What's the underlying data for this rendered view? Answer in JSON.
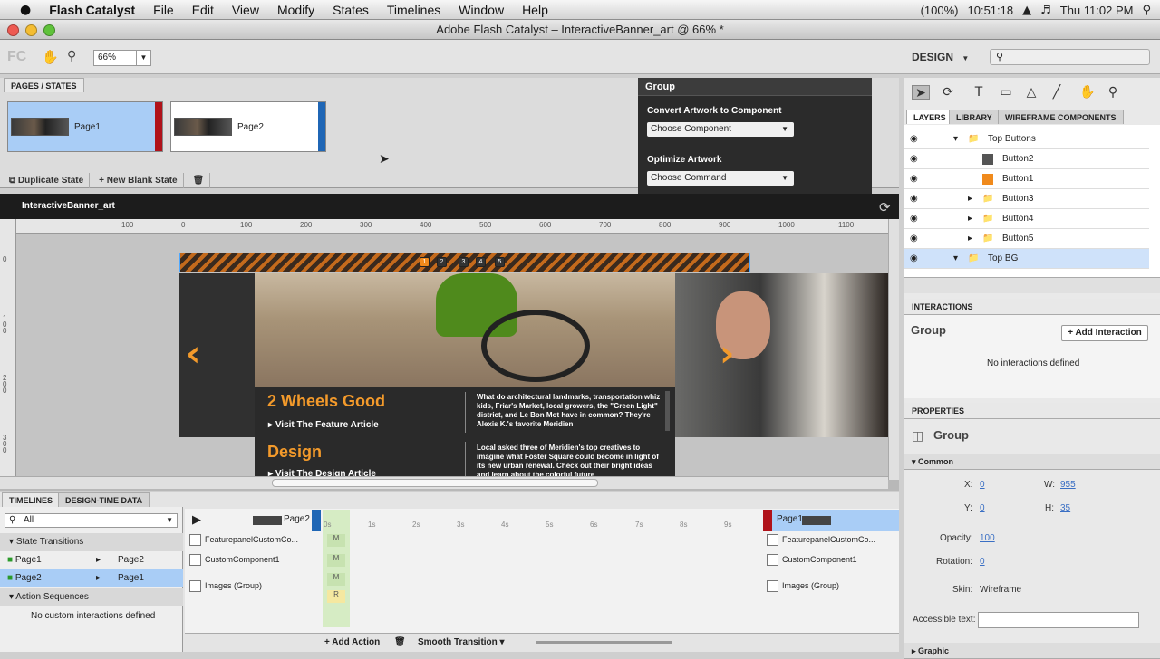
{
  "menubar": {
    "apple": "",
    "app": "Flash Catalyst",
    "items": [
      "File",
      "Edit",
      "View",
      "Modify",
      "States",
      "Timelines",
      "Window",
      "Help"
    ],
    "battery": "(100%)",
    "time": "10:51:18",
    "clock": "Thu 11:02 PM"
  },
  "window": {
    "title": "Adobe Flash Catalyst – InteractiveBanner_art @ 66% *"
  },
  "toolbar": {
    "logo": "FC",
    "zoom": "66%",
    "workspace": "DESIGN"
  },
  "pages": {
    "tab": "PAGES / STATES",
    "items": [
      {
        "label": "Page1"
      },
      {
        "label": "Page2"
      }
    ],
    "duplicate": "Duplicate State",
    "new_blank": "New Blank State"
  },
  "hud": {
    "title": "Group",
    "convert_label": "Convert Artwork to Component",
    "convert_value": "Choose Component",
    "optimize_label": "Optimize Artwork",
    "optimize_value": "Choose Command"
  },
  "artboard": {
    "name": "InteractiveBanner_art",
    "ruler_h": [
      "100",
      "0",
      "100",
      "200",
      "300",
      "400",
      "500",
      "600",
      "700",
      "800",
      "900",
      "1000",
      "1100"
    ],
    "ruler_v": [
      "0",
      "1 0 0",
      "2 0 0",
      "3 0 0"
    ]
  },
  "banner": {
    "nav_dots": [
      "1",
      "2",
      "3",
      "4",
      "5"
    ],
    "feature1": {
      "title": "2 Wheels Good",
      "link": "Visit The Feature Article",
      "text": "What do architectural landmarks, transportation whiz kids, Friar's Market, local growers, the \"Green Light\" district, and Le Bon Mot have in common? They're Alexis K.'s favorite Meridien"
    },
    "feature2": {
      "title": "Design",
      "link": "Visit The Design Article",
      "text": "Local asked three of Meridien's top creatives to imagine what Foster Square could become in light of its new urban renewal. Check out their bright ideas and learn about the colorful future"
    }
  },
  "timelines": {
    "tabs": [
      "TIMELINES",
      "DESIGN-TIME DATA"
    ],
    "filter": "All",
    "state_transitions": "State Transitions",
    "transitions": [
      {
        "from": "Page1",
        "to": "Page2"
      },
      {
        "from": "Page2",
        "to": "Page1"
      }
    ],
    "action_sequences": "Action Sequences",
    "no_custom": "No custom interactions defined",
    "from_state": "Page2",
    "to_state": "Page1",
    "ticks": [
      "0s",
      "1s",
      "2s",
      "3s",
      "4s",
      "5s",
      "6s",
      "7s",
      "8s",
      "9s"
    ],
    "left_rows": [
      "FeaturepanelCustomCo...",
      "CustomComponent1",
      "Images (Group)"
    ],
    "right_rows": [
      "FeaturepanelCustomCo...",
      "CustomComponent1",
      "Images (Group)"
    ],
    "markers": [
      "M",
      "M",
      "M",
      "R"
    ],
    "add_action": "Add Action",
    "smooth": "Smooth Transition"
  },
  "layers": {
    "tabs": [
      "LAYERS",
      "LIBRARY",
      "WIREFRAME COMPONENTS"
    ],
    "rows": [
      {
        "name": "Top Buttons"
      },
      {
        "name": "Button2"
      },
      {
        "name": "Button1"
      },
      {
        "name": "Button3"
      },
      {
        "name": "Button4"
      },
      {
        "name": "Button5"
      },
      {
        "name": "Top BG"
      }
    ]
  },
  "interactions": {
    "header": "INTERACTIONS",
    "title": "Group",
    "add": "Add Interaction",
    "none": "No interactions defined"
  },
  "properties": {
    "header": "PROPERTIES",
    "title": "Group",
    "section": "Common",
    "x_label": "X:",
    "x": "0",
    "w_label": "W:",
    "w": "955",
    "y_label": "Y:",
    "y": "0",
    "h_label": "H:",
    "h": "35",
    "opacity_label": "Opacity:",
    "opacity": "100",
    "rotation_label": "Rotation:",
    "rotation": "0",
    "skin_label": "Skin:",
    "skin": "Wireframe",
    "accessible_label": "Accessible text:",
    "graphic": "Graphic"
  }
}
